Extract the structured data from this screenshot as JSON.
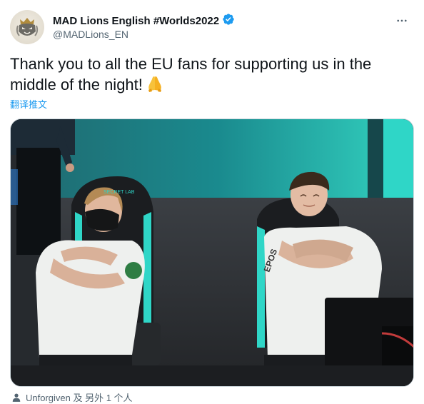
{
  "tweet": {
    "display_name": "MAD Lions English #Worlds2022",
    "handle": "@MADLions_EN",
    "text": "Thank you to all the EU fans for supporting us in the middle of the night!",
    "emoji": "🙏",
    "translate_label": "翻译推文",
    "verified": true
  },
  "media": {
    "jersey_sponsor": "EPOS",
    "chair_brand": "SECRET LAB"
  },
  "tagged": {
    "text": "Unforgiven 及 另外 1 个人"
  },
  "colors": {
    "verified": "#1d9bf0",
    "link": "#1d9bf0",
    "text_primary": "#0f1419",
    "text_secondary": "#536471",
    "accent_teal": "#2fc8b9"
  },
  "icons": {
    "verified": "verified-badge-icon",
    "more": "more-options-icon",
    "emoji": "folded-hands-icon",
    "tagged": "person-icon"
  }
}
